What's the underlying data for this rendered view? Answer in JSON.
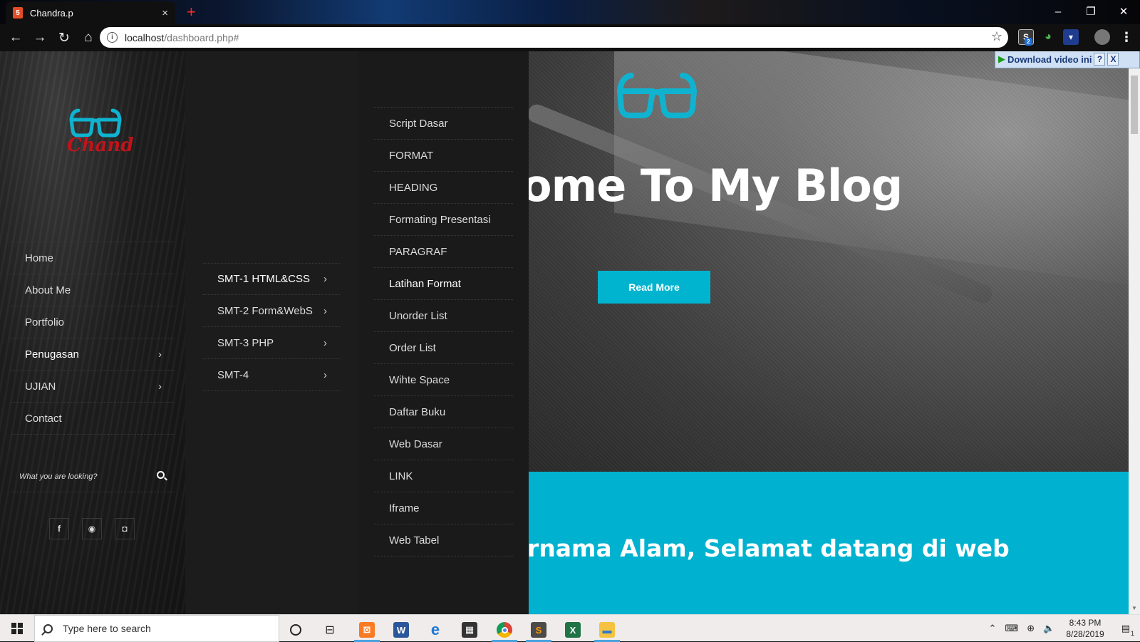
{
  "browser": {
    "tab_title": "Chandra.p",
    "tab_close": "×",
    "new_tab": "+",
    "url_host": "localhost",
    "url_path": "/dashboard.php#",
    "extension_badge": "2"
  },
  "window_controls": {
    "minimize": "–",
    "restore": "❐",
    "close": "✕"
  },
  "download_bar": {
    "label": "Download video ini",
    "help": "?",
    "close": "X"
  },
  "logo_text": "Chand",
  "sidebar": {
    "items": [
      {
        "label": "Home",
        "has_submenu": false
      },
      {
        "label": "About Me",
        "has_submenu": false
      },
      {
        "label": "Portfolio",
        "has_submenu": false
      },
      {
        "label": "Penugasan",
        "has_submenu": true,
        "active": true
      },
      {
        "label": "UJIAN",
        "has_submenu": true
      },
      {
        "label": "Contact",
        "has_submenu": false
      }
    ],
    "search_placeholder": "What you are looking?",
    "socials": [
      "f",
      "p",
      "ig"
    ]
  },
  "submenu1": {
    "items": [
      {
        "label": "SMT-1 HTML&CSS",
        "active": true
      },
      {
        "label": "SMT-2 Form&WebS"
      },
      {
        "label": "SMT-3 PHP"
      },
      {
        "label": "SMT-4"
      }
    ]
  },
  "submenu2": {
    "items": [
      {
        "label": "Script Dasar"
      },
      {
        "label": "FORMAT"
      },
      {
        "label": "HEADING"
      },
      {
        "label": "Formating Presentasi"
      },
      {
        "label": "PARAGRAF"
      },
      {
        "label": "Latihan Format",
        "active": true
      },
      {
        "label": "Unorder List"
      },
      {
        "label": "Order List"
      },
      {
        "label": "Wihte Space"
      },
      {
        "label": "Daftar Buku"
      },
      {
        "label": "Web Dasar"
      },
      {
        "label": "LINK"
      },
      {
        "label": "Iframe"
      },
      {
        "label": "Web Tabel"
      }
    ]
  },
  "hero": {
    "title": "ome To My Blog",
    "button": "Read More"
  },
  "band": {
    "text": "rnama Alam, Selamat datang di web"
  },
  "taskbar": {
    "search_placeholder": "Type here to search",
    "time": "8:43 PM",
    "date": "8/28/2019",
    "notification_count": "1"
  },
  "colors": {
    "accent": "#00b4d0",
    "logo_red": "#c0141a",
    "sidebar_bg": "#141414"
  }
}
